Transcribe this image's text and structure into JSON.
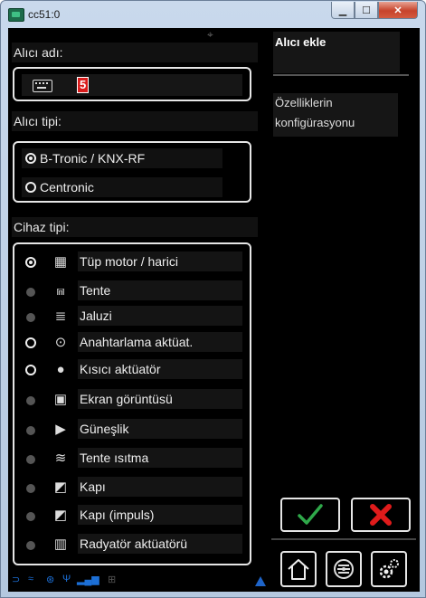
{
  "window": {
    "title": "cc51:0",
    "min_label": "▁",
    "max_label": "☐",
    "close_label": "✕"
  },
  "form": {
    "receiver_name_label": "Alıcı adı:",
    "receiver_name_value": "5",
    "receiver_type_label": "Alıcı tipi:",
    "receiver_types": [
      {
        "label": "B-Tronic / KNX-RF",
        "selected": true
      },
      {
        "label": "Centronic",
        "selected": false
      }
    ],
    "device_type_label": "Cihaz tipi:",
    "device_types": [
      {
        "label": "Tüp motor / harici",
        "icon": "tube-motor-icon",
        "state": "selected"
      },
      {
        "label": "Tente",
        "icon": "awning-icon",
        "state": "disabled"
      },
      {
        "label": "Jaluzi",
        "icon": "blind-icon",
        "state": "disabled"
      },
      {
        "label": "Anahtarlama aktüat.",
        "icon": "socket-icon",
        "state": "enabled"
      },
      {
        "label": "Kısıcı aktüatör",
        "icon": "bulb-icon",
        "state": "enabled"
      },
      {
        "label": "Ekran görüntüsü",
        "icon": "screen-icon",
        "state": "disabled"
      },
      {
        "label": "Güneşlik",
        "icon": "sunshade-icon",
        "state": "disabled"
      },
      {
        "label": "Tente ısıtma",
        "icon": "awning-heating-icon",
        "state": "disabled"
      },
      {
        "label": "Kapı",
        "icon": "gate-icon",
        "state": "disabled"
      },
      {
        "label": "Kapı (impuls)",
        "icon": "gate-impulse-icon",
        "state": "disabled"
      },
      {
        "label": "Radyatör aktüatörü",
        "icon": "radiator-icon",
        "state": "disabled"
      }
    ]
  },
  "sidebar": {
    "title": "Alıcı ekle",
    "config_label": "Özelliklerin konfigürasyonu"
  },
  "colors": {
    "confirm": "#2fa84a",
    "cancel": "#e01b1b",
    "status_blue": "#1e64c8"
  }
}
